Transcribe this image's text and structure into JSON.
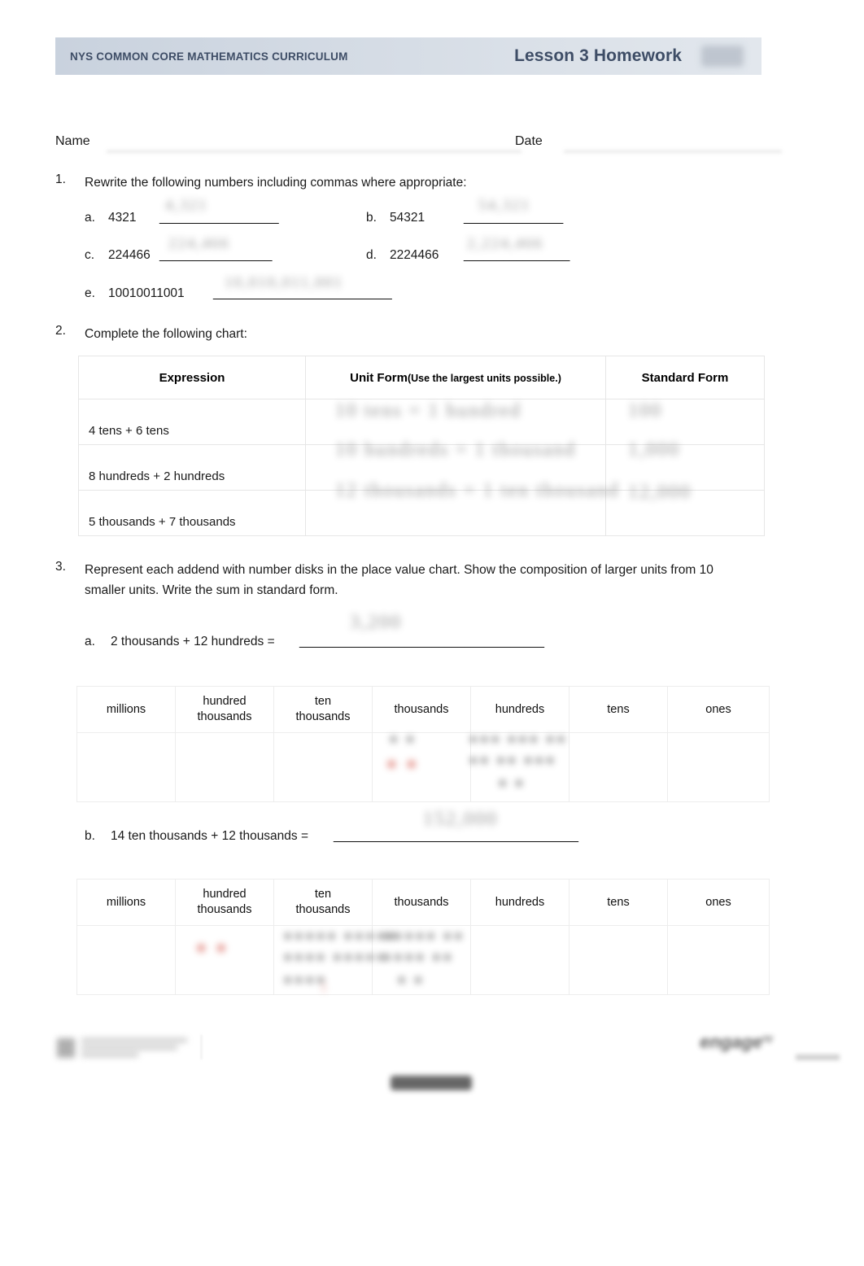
{
  "header": {
    "curriculum": "NYS COMMON CORE MATHEMATICS CURRICULUM",
    "lesson": "Lesson 3 Homework",
    "redacted_badge": "",
    "banner_color_start": "#c9d2de",
    "banner_color_end": "#e2e7ed",
    "title_color": "#3e4d66"
  },
  "name_date": {
    "name_label": "Name",
    "date_label": "Date",
    "name_value_redacted": "",
    "date_value_redacted": ""
  },
  "questions": [
    {
      "number": "1.",
      "prompt": "Rewrite the following numbers including commas where appropriate:",
      "items": [
        {
          "letter": "a.",
          "value": "4321",
          "blank": "__________________",
          "answer_redacted": ""
        },
        {
          "letter": "b.",
          "value": "54321",
          "blank": "_______________",
          "answer_redacted": ""
        },
        {
          "letter": "c.",
          "value": "224466",
          "blank": "_________________",
          "answer_redacted": ""
        },
        {
          "letter": "d.",
          "value": "2224466",
          "blank": "________________",
          "answer_redacted": ""
        },
        {
          "letter": "e.",
          "value": "10010011001",
          "blank": "___________________________",
          "answer_redacted": ""
        }
      ]
    },
    {
      "number": "2.",
      "prompt": "Complete the following chart:"
    },
    {
      "number": "3.",
      "prompt": "Represent each addend with number disks in the place value chart. Show the composition of larger units from 10 smaller units. Write the sum in standard form.",
      "items": [
        {
          "letter": "a.",
          "expression": "2 thousands + 12 hundreds =",
          "blank": "_____________________________________",
          "answer_redacted": ""
        },
        {
          "letter": "b.",
          "expression": "14 ten thousands + 12 thousands =",
          "blank": "_____________________________________",
          "answer_redacted": ""
        }
      ]
    }
  ],
  "chart_data": {
    "type": "table",
    "title": "Complete the following chart:",
    "columns": [
      "Expression",
      "Unit Form (Use the largest units possible.)",
      "Standard Form"
    ],
    "column_header_main": [
      "Expression",
      "Unit Form",
      "Standard Form"
    ],
    "column_header_sub": [
      "",
      "(Use the largest units possible.)",
      ""
    ],
    "rows": [
      {
        "expression": "4 tens + 6 tens",
        "unit_form": "",
        "standard_form": ""
      },
      {
        "expression": "8 hundreds + 2 hundreds",
        "unit_form": "",
        "standard_form": ""
      },
      {
        "expression": "5 thousands + 7 thousands",
        "unit_form": "",
        "standard_form": ""
      }
    ]
  },
  "place_value_charts": [
    {
      "id": "chart-a",
      "headers": [
        "millions",
        "hundred thousands",
        "ten thousands",
        "thousands",
        "hundreds",
        "tens",
        "ones"
      ],
      "headers_line1": [
        "millions",
        "hundred",
        "ten",
        "thousands",
        "hundreds",
        "tens",
        "ones"
      ],
      "headers_line2": [
        "",
        "thousands",
        "thousands",
        "",
        "",
        "",
        ""
      ],
      "cells": [
        "",
        "",
        "",
        "",
        "",
        "",
        ""
      ]
    },
    {
      "id": "chart-b",
      "headers": [
        "millions",
        "hundred thousands",
        "ten thousands",
        "thousands",
        "hundreds",
        "tens",
        "ones"
      ],
      "headers_line1": [
        "millions",
        "hundred",
        "ten",
        "thousands",
        "hundreds",
        "tens",
        "ones"
      ],
      "headers_line2": [
        "",
        "thousands",
        "thousands",
        "",
        "",
        "",
        ""
      ],
      "cells": [
        "",
        "",
        "",
        "",
        "",
        "",
        ""
      ]
    }
  ],
  "footer": {
    "center_redacted": "",
    "brand": "engage",
    "brand_sup": "ny"
  }
}
